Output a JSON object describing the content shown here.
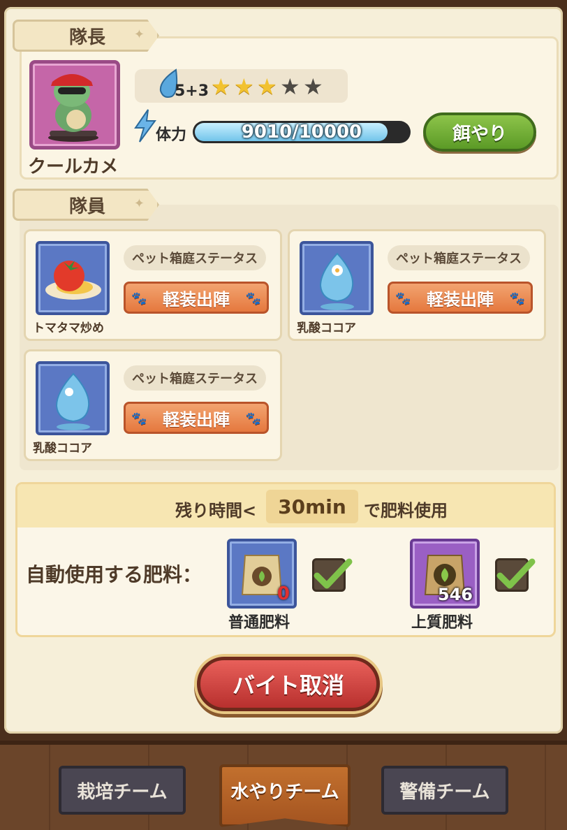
{
  "leader": {
    "section_title": "隊長",
    "name": "クールカメ",
    "rank_text": "5+3",
    "stars_filled": 3,
    "stars_total": 5,
    "hp_label": "体力",
    "hp_text": "9010/10000",
    "hp_fraction": 0.901,
    "feed_button": "餌やり"
  },
  "members": {
    "section_title": "隊員",
    "items": [
      {
        "name": "トマタマ炒め",
        "status_label": "ペット箱庭ステータス",
        "deploy_label": "軽装出陣",
        "icon": "tomato-omelette-icon"
      },
      {
        "name": "乳酸ココア",
        "status_label": "ペット箱庭ステータス",
        "deploy_label": "軽装出陣",
        "icon": "blue-slime-icon"
      },
      {
        "name": "乳酸ココア",
        "status_label": "ペット箱庭ステータス",
        "deploy_label": "軽装出陣",
        "icon": "blue-slime-icon"
      }
    ]
  },
  "fertilizer": {
    "prefix": "残り時間<",
    "time": "30min",
    "suffix": "で肥料使用",
    "auto_label": "自動使用する肥料：",
    "items": [
      {
        "name": "普通肥料",
        "count": "0",
        "checked": true
      },
      {
        "name": "上質肥料",
        "count": "546",
        "checked": true
      }
    ]
  },
  "cancel_button": "バイト取消",
  "tabs": [
    {
      "label": "栽培チーム",
      "active": false
    },
    {
      "label": "水やりチーム",
      "active": true
    },
    {
      "label": "警備チーム",
      "active": false
    }
  ],
  "colors": {
    "panel_bg": "#f6efd9",
    "green_button": "#6fae34",
    "orange_button": "#e5783e",
    "red_button": "#c83a36",
    "active_tab": "#b8652a"
  }
}
